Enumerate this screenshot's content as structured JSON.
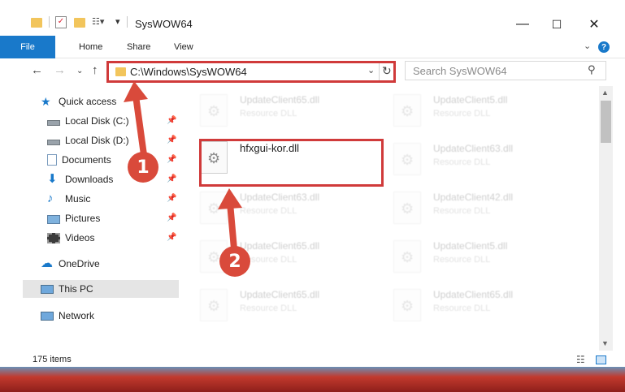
{
  "window": {
    "title": "SysWOW64",
    "minimize_glyph": "—",
    "maximize_glyph": "☐",
    "close_glyph": "✕"
  },
  "ribbon": {
    "tabs": [
      "File",
      "Home",
      "Share",
      "View"
    ],
    "help": "?"
  },
  "address": {
    "path": "C:\\Windows\\SysWOW64"
  },
  "search": {
    "placeholder": "Search SysWOW64"
  },
  "nav": {
    "items": [
      {
        "label": "Quick access",
        "icon": "star-icon",
        "pinned": false
      },
      {
        "label": "Local Disk (C:)",
        "icon": "drive-icon",
        "pinned": true
      },
      {
        "label": "Local Disk (D:)",
        "icon": "drive-icon",
        "pinned": true
      },
      {
        "label": "Documents",
        "icon": "documents-icon",
        "pinned": true
      },
      {
        "label": "Downloads",
        "icon": "download-icon",
        "pinned": true
      },
      {
        "label": "Music",
        "icon": "music-icon",
        "pinned": true
      },
      {
        "label": "Pictures",
        "icon": "pictures-icon",
        "pinned": true
      },
      {
        "label": "Videos",
        "icon": "videos-icon",
        "pinned": true
      },
      {
        "label": "OneDrive",
        "icon": "cloud-icon",
        "pinned": false
      },
      {
        "label": "This PC",
        "icon": "computer-icon",
        "pinned": false
      },
      {
        "label": "Network",
        "icon": "network-icon",
        "pinned": false
      }
    ]
  },
  "files": [
    {
      "name": "UpdateClient65.dll",
      "type": "Resource DLL",
      "faded": true
    },
    {
      "name": "UpdateClient5.dll",
      "type": "Resource DLL",
      "faded": true
    },
    {
      "name": "hfxgui-kor.dll",
      "type": "",
      "faded": false
    },
    {
      "name": "UpdateClient63.dll",
      "type": "Resource DLL",
      "faded": true
    },
    {
      "name": "UpdateClient63.dll",
      "type": "Resource DLL",
      "faded": true
    },
    {
      "name": "UpdateClient42.dll",
      "type": "Resource DLL",
      "faded": true
    },
    {
      "name": "UpdateClient65.dll",
      "type": "Resource DLL",
      "faded": true
    },
    {
      "name": "UpdateClient5.dll",
      "type": "Resource DLL",
      "faded": true
    },
    {
      "name": "UpdateClient65.dll",
      "type": "Resource DLL",
      "faded": true
    },
    {
      "name": "UpdateClient65.dll",
      "type": "Resource DLL",
      "faded": true
    }
  ],
  "status": {
    "count": "175 items"
  },
  "annotations": {
    "step1": "1",
    "step2": "2",
    "color": "#d94a3b"
  }
}
